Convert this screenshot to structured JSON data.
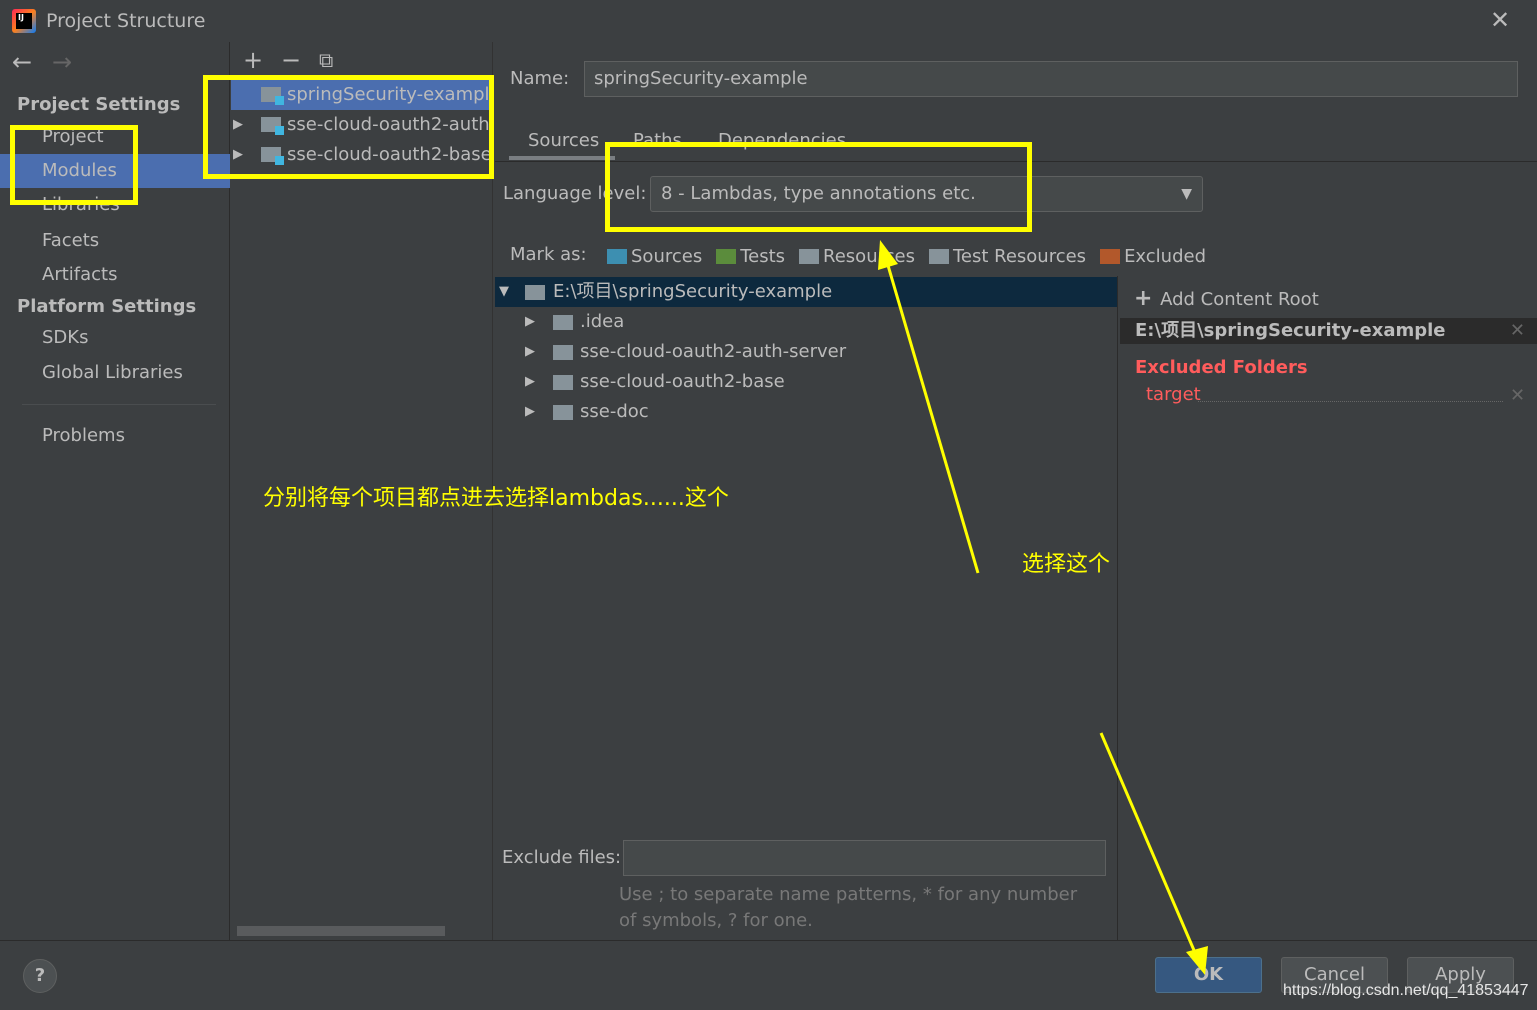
{
  "window": {
    "title": "Project Structure",
    "close_icon": "close-icon"
  },
  "sidebar": {
    "project_settings": "Project Settings",
    "items": [
      {
        "label": "Project"
      },
      {
        "label": "Modules",
        "selected": true
      },
      {
        "label": "Libraries"
      },
      {
        "label": "Facets"
      },
      {
        "label": "Artifacts"
      }
    ],
    "platform_settings": "Platform Settings",
    "platform_items": [
      {
        "label": "SDKs"
      },
      {
        "label": "Global Libraries"
      }
    ],
    "problems": "Problems"
  },
  "modules": [
    {
      "name": "springSecurity-example",
      "selected": true
    },
    {
      "name": "sse-cloud-oauth2-auth"
    },
    {
      "name": "sse-cloud-oauth2-base"
    }
  ],
  "detail": {
    "name_label": "Name:",
    "name_value": "springSecurity-example",
    "tabs": [
      "Sources",
      "Paths",
      "Dependencies"
    ],
    "language_label": "Language level:",
    "language_value": "8 - Lambdas, type annotations etc.",
    "mark_as": "Mark as:",
    "marks": [
      {
        "label": "Sources",
        "color": "#3d8fb1"
      },
      {
        "label": "Tests",
        "color": "#5b8c3c"
      },
      {
        "label": "Resources",
        "color": "#87939a"
      },
      {
        "label": "Test Resources",
        "color": "#87939a"
      },
      {
        "label": "Excluded",
        "color": "#b2582b"
      }
    ],
    "tree": {
      "root": "E:\\项目\\springSecurity-example",
      "children": [
        ".idea",
        "sse-cloud-oauth2-auth-server",
        "sse-cloud-oauth2-base",
        "sse-doc"
      ]
    },
    "add_content_root": "Add Content Root",
    "content_root": "E:\\项目\\springSecurity-example",
    "excluded_header": "Excluded Folders",
    "excluded_item": "target",
    "exclude_files_label": "Exclude files:",
    "exclude_files_value": "",
    "exclude_hint": "Use ; to separate name patterns, * for any number of symbols, ? for one."
  },
  "footer": {
    "help": "?",
    "ok": "OK",
    "cancel": "Cancel",
    "apply": "Apply"
  },
  "annotations": {
    "main": "分别将每个项目都点进去选择lambdas......这个",
    "select": "选择这个",
    "color": "#ffff00"
  },
  "watermark": "https://blog.csdn.net/qq_41853447"
}
